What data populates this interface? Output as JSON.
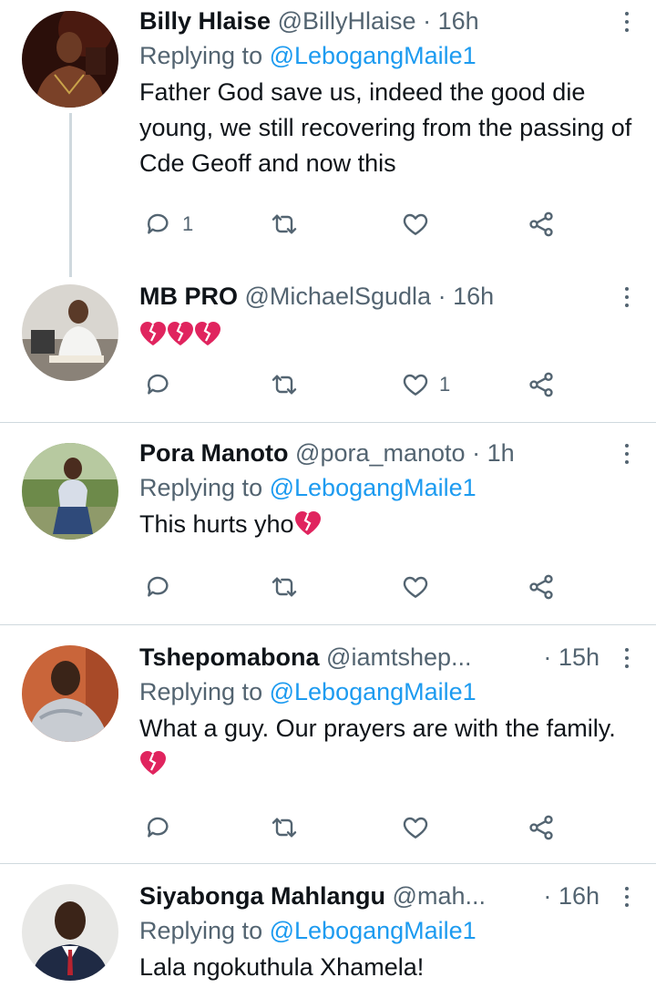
{
  "colors": {
    "text": "#0f1419",
    "secondary": "#536471",
    "link": "#1d9bf0",
    "divider": "#cfd9de",
    "broken_heart": "#e0245e"
  },
  "icons": {
    "reply": "reply-icon",
    "retweet": "retweet-icon",
    "like": "heart-icon",
    "share": "share-icon",
    "more": "more-options-icon",
    "emoji": "broken-heart-emoji"
  },
  "tweets": [
    {
      "name": "Billy Hlaise",
      "handle": "@BillyHlaise",
      "separator": "·",
      "time": "16h",
      "replying_prefix": "Replying to",
      "replying_to": "@LebogangMaile1",
      "text": "Father God save us, indeed the good die young,  we still recovering from the passing of Cde Geoff and now this",
      "reply_count": "1",
      "retweet_count": "",
      "like_count": ""
    },
    {
      "name": "MB PRO",
      "handle": "@MichaelSgudla",
      "separator": "·",
      "time": "16h",
      "emoji_text": "💔💔💔",
      "reply_count": "",
      "retweet_count": "",
      "like_count": "1"
    },
    {
      "name": "Pora Manoto",
      "handle": "@pora_manoto",
      "separator": "·",
      "time": "1h",
      "replying_prefix": "Replying to",
      "replying_to": "@LebogangMaile1",
      "text": "This hurts yho",
      "reply_count": "",
      "retweet_count": "",
      "like_count": ""
    },
    {
      "name": "Tshepomabona",
      "handle": "@iamtshep...",
      "separator": "·",
      "time": "15h",
      "replying_prefix": "Replying to",
      "replying_to": "@LebogangMaile1",
      "text": "What a guy. Our prayers are with the family.",
      "reply_count": "",
      "retweet_count": "",
      "like_count": ""
    },
    {
      "name": "Siyabonga Mahlangu",
      "handle": "@mah...",
      "separator": "·",
      "time": "16h",
      "replying_prefix": "Replying to",
      "replying_to": "@LebogangMaile1",
      "text": "Lala ngokuthula Xhamela!"
    }
  ]
}
